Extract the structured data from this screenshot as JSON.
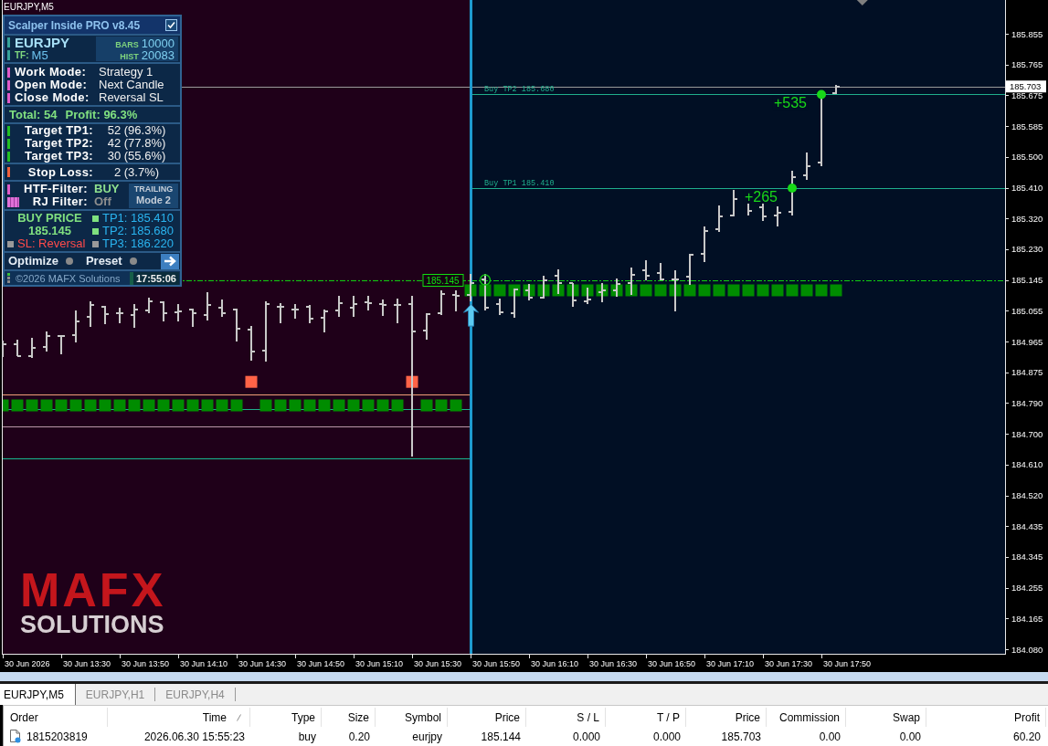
{
  "chart": {
    "title": "EURJPY,M5",
    "price_labels": [
      "185.855",
      "185.765",
      "185.675",
      "185.585",
      "185.500",
      "185.410",
      "185.320",
      "185.230",
      "185.145",
      "185.055",
      "184.965",
      "184.875",
      "184.790",
      "184.700",
      "184.610",
      "184.520",
      "184.435",
      "184.345",
      "184.255",
      "184.165",
      "184.080"
    ],
    "current_price": "185.703",
    "time_labels": [
      "30 Jun 2026",
      "30 Jun 13:30",
      "30 Jun 13:50",
      "30 Jun 14:10",
      "30 Jun 14:30",
      "30 Jun 14:50",
      "30 Jun 15:10",
      "30 Jun 15:30",
      "30 Jun 15:50",
      "30 Jun 16:10",
      "30 Jun 16:30",
      "30 Jun 16:50",
      "30 Jun 17:10",
      "30 Jun 17:30",
      "30 Jun 17:50"
    ],
    "target_lines": [
      "Buy TP2 185.680",
      "Buy TP1 185.410"
    ],
    "profit_marks": [
      "+535",
      "+265"
    ],
    "entry_tag": "185.145"
  },
  "panel": {
    "title": "Scalper Inside PRO v8.45",
    "checked": true,
    "symbol": "EURJPY",
    "timeframe": {
      "label": "TF:",
      "value": "M5"
    },
    "stats": [
      {
        "label": "BARS",
        "value": "10000"
      },
      {
        "label": "HIST",
        "value": "20083"
      }
    ],
    "modes": [
      {
        "label": "Work Mode:",
        "value": "Strategy 1"
      },
      {
        "label": "Open Mode:",
        "value": "Next Candle"
      },
      {
        "label": "Close Mode:",
        "value": "Reversal SL"
      }
    ],
    "summary": [
      "Total: 54",
      "Profit: 96.3%"
    ],
    "targets": [
      {
        "label": "Target TP1:",
        "value": "52 (96.3%)"
      },
      {
        "label": "Target TP2:",
        "value": "42 (77.8%)"
      },
      {
        "label": "Target TP3:",
        "value": "30 (55.6%)"
      }
    ],
    "stop_loss": {
      "label": "Stop Loss:",
      "value": "2 (3.7%)"
    },
    "filters": [
      {
        "label": "HTF-Filter:",
        "value": "BUY",
        "on": true
      },
      {
        "label": "RJ Filter:",
        "value": "Off",
        "on": false
      }
    ],
    "trailing": {
      "title": "TRAILING",
      "mode": "Mode 2"
    },
    "buy_price": {
      "label": "BUY PRICE",
      "value": "185.145"
    },
    "stop": {
      "label": "SL: Reversal",
      "hit": false
    },
    "take_profits": [
      {
        "label": "TP1: 185.410",
        "hit": true
      },
      {
        "label": "TP2: 185.680",
        "hit": true
      },
      {
        "label": "TP3: 186.220",
        "hit": false
      }
    ],
    "buttons": [
      {
        "label": "Optimize",
        "on": false
      },
      {
        "label": "Preset",
        "on": false
      }
    ],
    "copyright": "©2026 MAFX Solutions",
    "clock": "17:55:06"
  },
  "logo": {
    "title": "MAFX",
    "subtitle": "SOLUTIONS"
  },
  "tabs": [
    {
      "label": "EURJPY,M5",
      "selected": true
    },
    {
      "label": "EURJPY,H1",
      "selected": false
    },
    {
      "label": "EURJPY,H4",
      "selected": false
    }
  ],
  "orders_table": {
    "columns": [
      {
        "label": "Order",
        "sorted": false
      },
      {
        "label": "Time",
        "sorted": true
      },
      {
        "label": "Type",
        "sorted": false
      },
      {
        "label": "Size",
        "sorted": false
      },
      {
        "label": "Symbol",
        "sorted": false
      },
      {
        "label": "Price",
        "sorted": false
      },
      {
        "label": "S / L",
        "sorted": false
      },
      {
        "label": "T / P",
        "sorted": false
      },
      {
        "label": "Price",
        "sorted": false
      },
      {
        "label": "Commission",
        "sorted": false
      },
      {
        "label": "Swap",
        "sorted": false
      },
      {
        "label": "Profit",
        "sorted": false
      }
    ],
    "rows": [
      {
        "cells": [
          "1815203819",
          "2026.06.30 15:55:23",
          "buy",
          "0.20",
          "eurjpy",
          "185.144",
          "0.000",
          "0.000",
          "185.703",
          "0.00",
          "0.00",
          "60.20"
        ]
      }
    ]
  }
}
